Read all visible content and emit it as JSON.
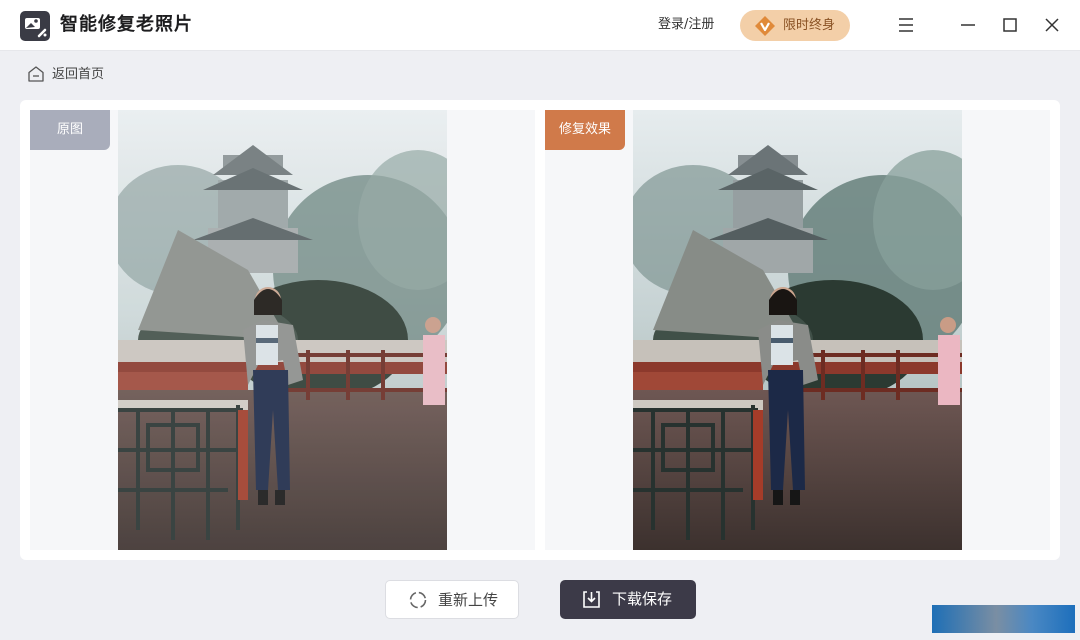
{
  "app": {
    "title": "智能修复老照片",
    "login_label": "登录/注册",
    "vip_label": "限时终身",
    "vip_icon": "v-diamond-icon",
    "icon": "photo-repair-app-icon"
  },
  "window_controls": {
    "menu_icon": "hamburger-icon",
    "minimize_icon": "minimize-icon",
    "maximize_icon": "maximize-icon",
    "close_icon": "close-icon"
  },
  "nav": {
    "back_label": "返回首页",
    "back_icon": "home-icon"
  },
  "compare": {
    "original_tag": "原图",
    "result_tag": "修复效果"
  },
  "actions": {
    "reupload_label": "重新上传",
    "reupload_icon": "refresh-icon",
    "save_label": "下载保存",
    "save_icon": "download-icon"
  },
  "colors": {
    "accent_orange": "#d07a4a",
    "tag_gray": "#a9adbb",
    "vip_bg": "#f3cfa8",
    "save_btn": "#3c3a48"
  }
}
